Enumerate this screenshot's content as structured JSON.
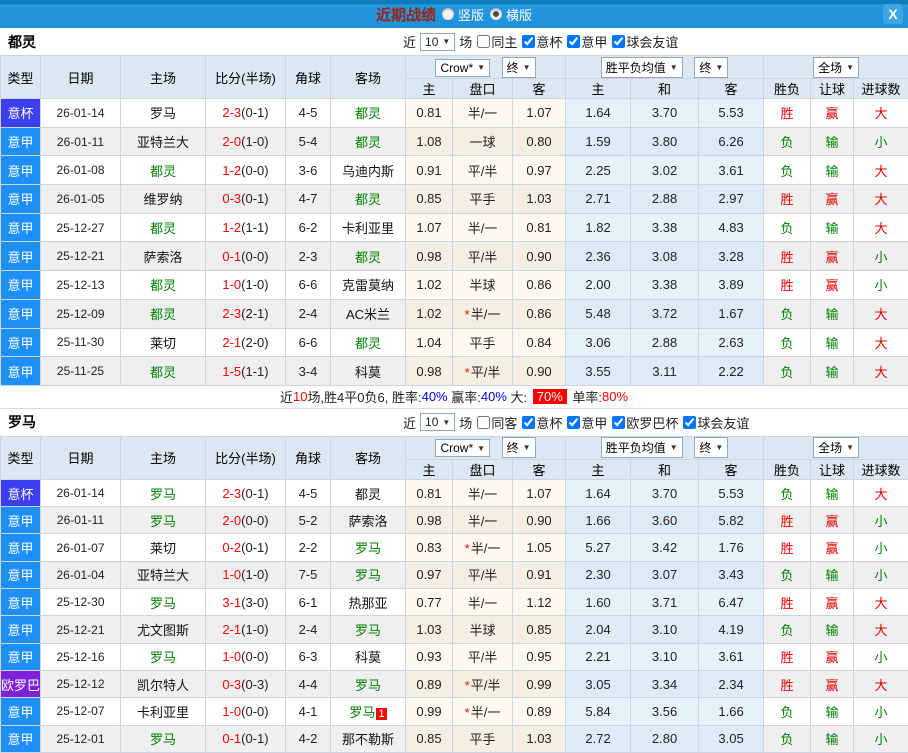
{
  "titlebar": {
    "title": "近期战绩",
    "vertical_label": "竖版",
    "horizontal_label": "横版",
    "close_label": "X"
  },
  "colors": {
    "cup": "#3d3df2",
    "league": "#1f8ff7",
    "europa": "#7d20d9",
    "win_red": "#e60000",
    "lose_green": "#008000",
    "highlight_red": "#ff0000",
    "topbar_blue": "#1e92d9"
  },
  "table_header": {
    "left": [
      "类型",
      "日期",
      "主场",
      "比分(半场)",
      "角球",
      "客场"
    ],
    "odds_cols": [
      "主",
      "盘口",
      "客"
    ],
    "avg_cols": [
      "主",
      "和",
      "客"
    ],
    "res_cols": [
      "胜负",
      "让球",
      "进球数"
    ],
    "dd_bookie": "Crow*",
    "dd_final1": "终",
    "dd_avg": "胜平负均值",
    "dd_final2": "终",
    "dd_scope": "全场"
  },
  "sections": [
    {
      "team": "都灵",
      "filter": {
        "near": "近",
        "count": "10",
        "games": "场",
        "same_label": "同主",
        "comps": [
          "意杯",
          "意甲",
          "球会友谊"
        ]
      },
      "rows": [
        {
          "type": "意杯",
          "tc": "cup",
          "date": "26-01-14",
          "home": "罗马",
          "hg": false,
          "score": "2-3",
          "half": "(0-1)",
          "corner": "4-5",
          "away": "都灵",
          "ag": true,
          "badge": "",
          "h": "0.81",
          "star": false,
          "hc": "半/一",
          "a": "1.07",
          "m1": "1.64",
          "m2": "3.70",
          "m3": "5.53",
          "r1": "胜",
          "c1": "r",
          "r2": "赢",
          "c2": "r",
          "r3": "大",
          "c3": "r"
        },
        {
          "type": "意甲",
          "tc": "league",
          "date": "26-01-11",
          "home": "亚特兰大",
          "hg": false,
          "score": "2-0",
          "half": "(1-0)",
          "corner": "5-4",
          "away": "都灵",
          "ag": true,
          "badge": "",
          "h": "1.08",
          "star": false,
          "hc": "一球",
          "a": "0.80",
          "m1": "1.59",
          "m2": "3.80",
          "m3": "6.26",
          "r1": "负",
          "c1": "g",
          "r2": "输",
          "c2": "g",
          "r3": "小",
          "c3": "g"
        },
        {
          "type": "意甲",
          "tc": "league",
          "date": "26-01-08",
          "home": "都灵",
          "hg": true,
          "score": "1-2",
          "half": "(0-0)",
          "corner": "3-6",
          "away": "乌迪内斯",
          "ag": false,
          "badge": "",
          "h": "0.91",
          "star": false,
          "hc": "平/半",
          "a": "0.97",
          "m1": "2.25",
          "m2": "3.02",
          "m3": "3.61",
          "r1": "负",
          "c1": "g",
          "r2": "输",
          "c2": "g",
          "r3": "大",
          "c3": "r"
        },
        {
          "type": "意甲",
          "tc": "league",
          "date": "26-01-05",
          "home": "维罗纳",
          "hg": false,
          "score": "0-3",
          "half": "(0-1)",
          "corner": "4-7",
          "away": "都灵",
          "ag": true,
          "badge": "",
          "h": "0.85",
          "star": false,
          "hc": "平手",
          "a": "1.03",
          "m1": "2.71",
          "m2": "2.88",
          "m3": "2.97",
          "r1": "胜",
          "c1": "r",
          "r2": "赢",
          "c2": "r",
          "r3": "大",
          "c3": "r"
        },
        {
          "type": "意甲",
          "tc": "league",
          "date": "25-12-27",
          "home": "都灵",
          "hg": true,
          "score": "1-2",
          "half": "(1-1)",
          "corner": "6-2",
          "away": "卡利亚里",
          "ag": false,
          "badge": "",
          "h": "1.07",
          "star": false,
          "hc": "半/一",
          "a": "0.81",
          "m1": "1.82",
          "m2": "3.38",
          "m3": "4.83",
          "r1": "负",
          "c1": "g",
          "r2": "输",
          "c2": "g",
          "r3": "大",
          "c3": "r"
        },
        {
          "type": "意甲",
          "tc": "league",
          "date": "25-12-21",
          "home": "萨索洛",
          "hg": false,
          "score": "0-1",
          "half": "(0-0)",
          "corner": "2-3",
          "away": "都灵",
          "ag": true,
          "badge": "",
          "h": "0.98",
          "star": false,
          "hc": "平/半",
          "a": "0.90",
          "m1": "2.36",
          "m2": "3.08",
          "m3": "3.28",
          "r1": "胜",
          "c1": "r",
          "r2": "赢",
          "c2": "r",
          "r3": "小",
          "c3": "g"
        },
        {
          "type": "意甲",
          "tc": "league",
          "date": "25-12-13",
          "home": "都灵",
          "hg": true,
          "score": "1-0",
          "half": "(1-0)",
          "corner": "6-6",
          "away": "克雷莫纳",
          "ag": false,
          "badge": "",
          "h": "1.02",
          "star": false,
          "hc": "半球",
          "a": "0.86",
          "m1": "2.00",
          "m2": "3.38",
          "m3": "3.89",
          "r1": "胜",
          "c1": "r",
          "r2": "赢",
          "c2": "r",
          "r3": "小",
          "c3": "g"
        },
        {
          "type": "意甲",
          "tc": "league",
          "date": "25-12-09",
          "home": "都灵",
          "hg": true,
          "score": "2-3",
          "half": "(2-1)",
          "corner": "2-4",
          "away": "AC米兰",
          "ag": false,
          "badge": "",
          "h": "1.02",
          "star": true,
          "hc": "半/一",
          "a": "0.86",
          "m1": "5.48",
          "m2": "3.72",
          "m3": "1.67",
          "r1": "负",
          "c1": "g",
          "r2": "输",
          "c2": "g",
          "r3": "大",
          "c3": "r"
        },
        {
          "type": "意甲",
          "tc": "league",
          "date": "25-11-30",
          "home": "莱切",
          "hg": false,
          "score": "2-1",
          "half": "(2-0)",
          "corner": "6-6",
          "away": "都灵",
          "ag": true,
          "badge": "",
          "h": "1.04",
          "star": false,
          "hc": "平手",
          "a": "0.84",
          "m1": "3.06",
          "m2": "2.88",
          "m3": "2.63",
          "r1": "负",
          "c1": "g",
          "r2": "输",
          "c2": "g",
          "r3": "大",
          "c3": "r"
        },
        {
          "type": "意甲",
          "tc": "league",
          "date": "25-11-25",
          "home": "都灵",
          "hg": true,
          "score": "1-5",
          "half": "(1-1)",
          "corner": "3-4",
          "away": "科莫",
          "ag": false,
          "badge": "",
          "h": "0.98",
          "star": true,
          "hc": "平/半",
          "a": "0.90",
          "m1": "3.55",
          "m2": "3.11",
          "m3": "2.22",
          "r1": "负",
          "c1": "g",
          "r2": "输",
          "c2": "g",
          "r3": "大",
          "c3": "r"
        }
      ],
      "summary_parts": [
        {
          "t": "近",
          "c": "k"
        },
        {
          "t": "10",
          "c": "r"
        },
        {
          "t": "场,胜4平0负6, ",
          "c": "k"
        },
        {
          "t": "胜率:",
          "c": "k"
        },
        {
          "t": "40%",
          "c": "b"
        },
        {
          "t": " 赢率:",
          "c": "k"
        },
        {
          "t": "40%",
          "c": "b"
        },
        {
          "t": " 大: ",
          "c": "k"
        },
        {
          "t": "70%",
          "c": "hl"
        },
        {
          "t": " 单率:",
          "c": "k"
        },
        {
          "t": "80%",
          "c": "r"
        }
      ]
    },
    {
      "team": "罗马",
      "filter": {
        "near": "近",
        "count": "10",
        "games": "场",
        "same_label": "同客",
        "comps": [
          "意杯",
          "意甲",
          "欧罗巴杯",
          "球会友谊"
        ]
      },
      "rows": [
        {
          "type": "意杯",
          "tc": "cup",
          "date": "26-01-14",
          "home": "罗马",
          "hg": true,
          "score": "2-3",
          "half": "(0-1)",
          "corner": "4-5",
          "away": "都灵",
          "ag": false,
          "badge": "",
          "h": "0.81",
          "star": false,
          "hc": "半/一",
          "a": "1.07",
          "m1": "1.64",
          "m2": "3.70",
          "m3": "5.53",
          "r1": "负",
          "c1": "g",
          "r2": "输",
          "c2": "g",
          "r3": "大",
          "c3": "r"
        },
        {
          "type": "意甲",
          "tc": "league",
          "date": "26-01-11",
          "home": "罗马",
          "hg": true,
          "score": "2-0",
          "half": "(0-0)",
          "corner": "5-2",
          "away": "萨索洛",
          "ag": false,
          "badge": "",
          "h": "0.98",
          "star": false,
          "hc": "半/一",
          "a": "0.90",
          "m1": "1.66",
          "m2": "3.60",
          "m3": "5.82",
          "r1": "胜",
          "c1": "r",
          "r2": "赢",
          "c2": "r",
          "r3": "小",
          "c3": "g"
        },
        {
          "type": "意甲",
          "tc": "league",
          "date": "26-01-07",
          "home": "莱切",
          "hg": false,
          "score": "0-2",
          "half": "(0-1)",
          "corner": "2-2",
          "away": "罗马",
          "ag": true,
          "badge": "",
          "h": "0.83",
          "star": true,
          "hc": "半/一",
          "a": "1.05",
          "m1": "5.27",
          "m2": "3.42",
          "m3": "1.76",
          "r1": "胜",
          "c1": "r",
          "r2": "赢",
          "c2": "r",
          "r3": "小",
          "c3": "g"
        },
        {
          "type": "意甲",
          "tc": "league",
          "date": "26-01-04",
          "home": "亚特兰大",
          "hg": false,
          "score": "1-0",
          "half": "(1-0)",
          "corner": "7-5",
          "away": "罗马",
          "ag": true,
          "badge": "",
          "h": "0.97",
          "star": false,
          "hc": "平/半",
          "a": "0.91",
          "m1": "2.30",
          "m2": "3.07",
          "m3": "3.43",
          "r1": "负",
          "c1": "g",
          "r2": "输",
          "c2": "g",
          "r3": "小",
          "c3": "g"
        },
        {
          "type": "意甲",
          "tc": "league",
          "date": "25-12-30",
          "home": "罗马",
          "hg": true,
          "score": "3-1",
          "half": "(3-0)",
          "corner": "6-1",
          "away": "热那亚",
          "ag": false,
          "badge": "",
          "h": "0.77",
          "star": false,
          "hc": "半/一",
          "a": "1.12",
          "m1": "1.60",
          "m2": "3.71",
          "m3": "6.47",
          "r1": "胜",
          "c1": "r",
          "r2": "赢",
          "c2": "r",
          "r3": "大",
          "c3": "r"
        },
        {
          "type": "意甲",
          "tc": "league",
          "date": "25-12-21",
          "home": "尤文图斯",
          "hg": false,
          "score": "2-1",
          "half": "(1-0)",
          "corner": "2-4",
          "away": "罗马",
          "ag": true,
          "badge": "",
          "h": "1.03",
          "star": false,
          "hc": "半球",
          "a": "0.85",
          "m1": "2.04",
          "m2": "3.10",
          "m3": "4.19",
          "r1": "负",
          "c1": "g",
          "r2": "输",
          "c2": "g",
          "r3": "大",
          "c3": "r"
        },
        {
          "type": "意甲",
          "tc": "league",
          "date": "25-12-16",
          "home": "罗马",
          "hg": true,
          "score": "1-0",
          "half": "(0-0)",
          "corner": "6-3",
          "away": "科莫",
          "ag": false,
          "badge": "",
          "h": "0.93",
          "star": false,
          "hc": "平/半",
          "a": "0.95",
          "m1": "2.21",
          "m2": "3.10",
          "m3": "3.61",
          "r1": "胜",
          "c1": "r",
          "r2": "赢",
          "c2": "r",
          "r3": "小",
          "c3": "g"
        },
        {
          "type": "欧罗巴杯",
          "tc": "europa",
          "date": "25-12-12",
          "home": "凯尔特人",
          "hg": false,
          "score": "0-3",
          "half": "(0-3)",
          "corner": "4-4",
          "away": "罗马",
          "ag": true,
          "badge": "",
          "h": "0.89",
          "star": true,
          "hc": "平/半",
          "a": "0.99",
          "m1": "3.05",
          "m2": "3.34",
          "m3": "2.34",
          "r1": "胜",
          "c1": "r",
          "r2": "赢",
          "c2": "r",
          "r3": "大",
          "c3": "r"
        },
        {
          "type": "意甲",
          "tc": "league",
          "date": "25-12-07",
          "home": "卡利亚里",
          "hg": false,
          "score": "1-0",
          "half": "(0-0)",
          "corner": "4-1",
          "away": "罗马",
          "ag": true,
          "badge": "1",
          "h": "0.99",
          "star": true,
          "hc": "半/一",
          "a": "0.89",
          "m1": "5.84",
          "m2": "3.56",
          "m3": "1.66",
          "r1": "负",
          "c1": "g",
          "r2": "输",
          "c2": "g",
          "r3": "小",
          "c3": "g"
        },
        {
          "type": "意甲",
          "tc": "league",
          "date": "25-12-01",
          "home": "罗马",
          "hg": true,
          "score": "0-1",
          "half": "(0-1)",
          "corner": "4-2",
          "away": "那不勒斯",
          "ag": false,
          "badge": "",
          "h": "0.85",
          "star": false,
          "hc": "平手",
          "a": "1.03",
          "m1": "2.72",
          "m2": "2.80",
          "m3": "3.05",
          "r1": "负",
          "c1": "g",
          "r2": "输",
          "c2": "g",
          "r3": "小",
          "c3": "g"
        }
      ]
    }
  ]
}
